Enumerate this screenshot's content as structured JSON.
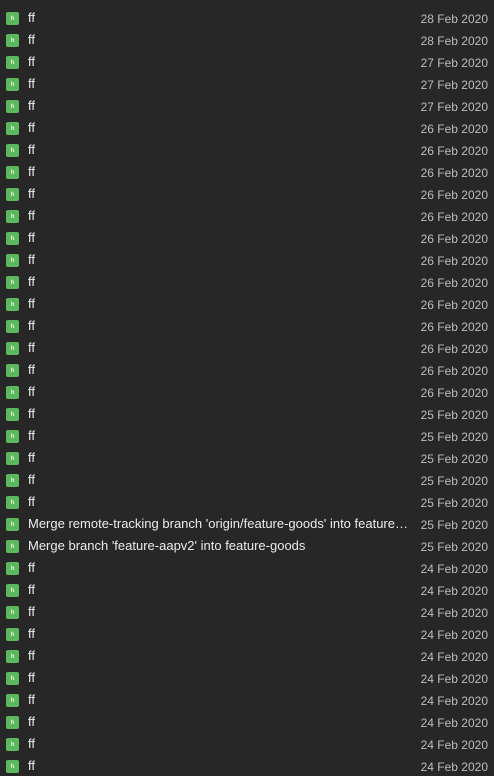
{
  "colors": {
    "background": "#272727",
    "icon": "#5cb85c",
    "message": "#ececec",
    "date": "#bdbdbd"
  },
  "icon": {
    "name": "file-status-icon",
    "glyph": "h"
  },
  "commits": [
    {
      "message": "ff",
      "date": "28 Feb 2020"
    },
    {
      "message": "ff",
      "date": "28 Feb 2020"
    },
    {
      "message": "ff",
      "date": "27 Feb 2020"
    },
    {
      "message": "ff",
      "date": "27 Feb 2020"
    },
    {
      "message": "ff",
      "date": "27 Feb 2020"
    },
    {
      "message": "ff",
      "date": "26 Feb 2020"
    },
    {
      "message": "ff",
      "date": "26 Feb 2020"
    },
    {
      "message": "ff",
      "date": "26 Feb 2020"
    },
    {
      "message": "ff",
      "date": "26 Feb 2020"
    },
    {
      "message": "ff",
      "date": "26 Feb 2020"
    },
    {
      "message": "ff",
      "date": "26 Feb 2020"
    },
    {
      "message": "ff",
      "date": "26 Feb 2020"
    },
    {
      "message": "ff",
      "date": "26 Feb 2020"
    },
    {
      "message": "ff",
      "date": "26 Feb 2020"
    },
    {
      "message": "ff",
      "date": "26 Feb 2020"
    },
    {
      "message": "ff",
      "date": "26 Feb 2020"
    },
    {
      "message": "ff",
      "date": "26 Feb 2020"
    },
    {
      "message": "ff",
      "date": "26 Feb 2020"
    },
    {
      "message": "ff",
      "date": "25 Feb 2020"
    },
    {
      "message": "ff",
      "date": "25 Feb 2020"
    },
    {
      "message": "ff",
      "date": "25 Feb 2020"
    },
    {
      "message": "ff",
      "date": "25 Feb 2020"
    },
    {
      "message": "ff",
      "date": "25 Feb 2020"
    },
    {
      "message": "Merge remote-tracking branch 'origin/feature-goods' into feature-goods",
      "date": "25 Feb 2020"
    },
    {
      "message": "Merge branch 'feature-aapv2' into feature-goods",
      "date": "25 Feb 2020"
    },
    {
      "message": "ff",
      "date": "24 Feb 2020"
    },
    {
      "message": "ff",
      "date": "24 Feb 2020"
    },
    {
      "message": "ff",
      "date": "24 Feb 2020"
    },
    {
      "message": "ff",
      "date": "24 Feb 2020"
    },
    {
      "message": "ff",
      "date": "24 Feb 2020"
    },
    {
      "message": "ff",
      "date": "24 Feb 2020"
    },
    {
      "message": "ff",
      "date": "24 Feb 2020"
    },
    {
      "message": "ff",
      "date": "24 Feb 2020"
    },
    {
      "message": "ff",
      "date": "24 Feb 2020"
    },
    {
      "message": "ff",
      "date": "24 Feb 2020"
    }
  ]
}
